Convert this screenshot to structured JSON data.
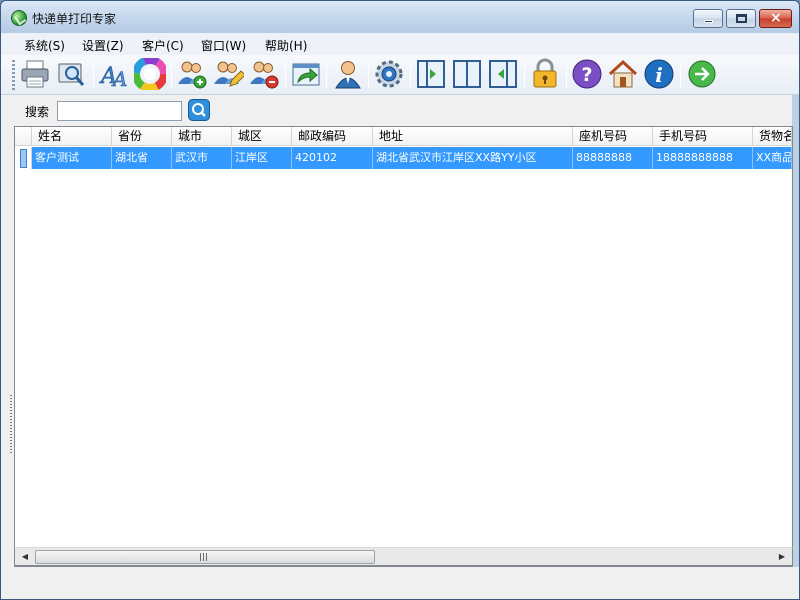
{
  "window": {
    "title": "快递单打印专家",
    "min_glyph": "minimize",
    "max_glyph": "maximize",
    "close_glyph": "×"
  },
  "menu": [
    "系统(S)",
    "设置(Z)",
    "客户(C)",
    "窗口(W)",
    "帮助(H)"
  ],
  "toolbar": {
    "icons": [
      "printer-icon",
      "print-preview-icon",
      "font-icon",
      "color-wheel-icon",
      "add-customer-icon",
      "edit-customer-icon",
      "delete-customer-icon",
      "export-icon",
      "user-icon",
      "settings-gear-icon",
      "panel-right-icon",
      "panel-split-icon",
      "panel-left-icon",
      "lock-icon",
      "help-icon",
      "home-icon",
      "info-icon",
      "next-arrow-icon"
    ]
  },
  "search": {
    "label": "搜索",
    "value": "",
    "button_icon": "search-icon"
  },
  "table": {
    "columns": [
      "姓名",
      "省份",
      "城市",
      "城区",
      "邮政编码",
      "地址",
      "座机号码",
      "手机号码",
      "货物名"
    ],
    "rows": [
      [
        "客户测试",
        "湖北省",
        "武汉市",
        "江岸区",
        "420102",
        "湖北省武汉市江岸区XX路YY小区",
        "88888888",
        "18888888888",
        "XX商品"
      ]
    ],
    "selected_row": 0
  },
  "scrollbar": {
    "left_arrow": "◀",
    "right_arrow": "▶"
  },
  "colors": {
    "selection": "#3399ff",
    "titlebar": "#c3d6ec",
    "close_button": "#c4402b"
  }
}
